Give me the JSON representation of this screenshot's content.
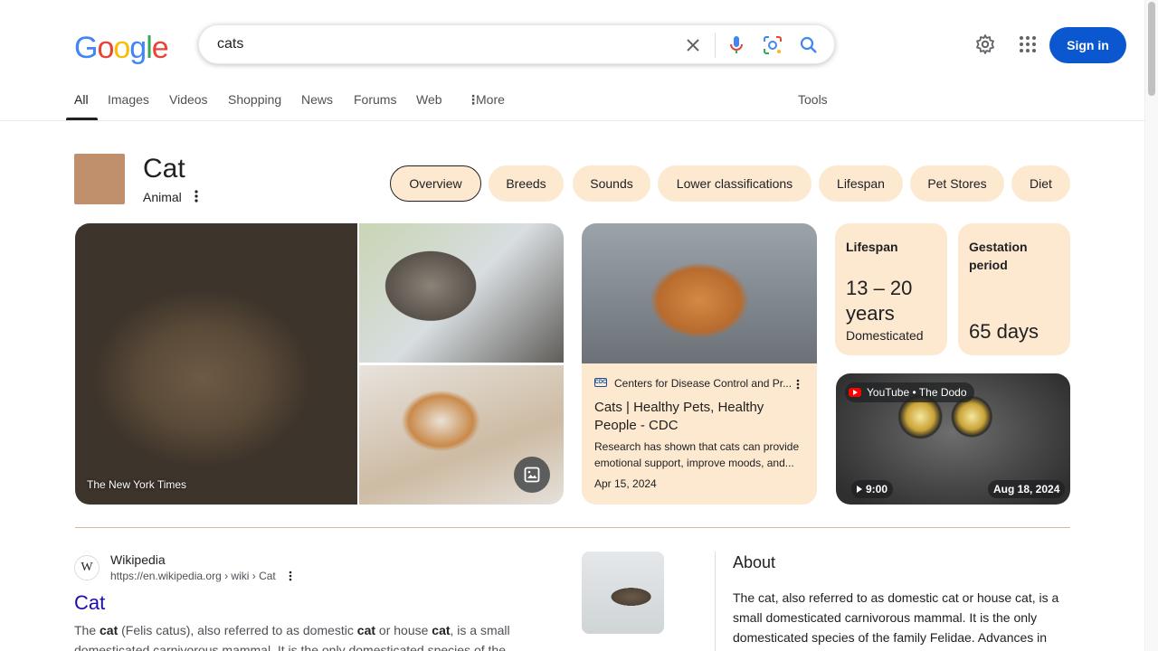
{
  "logo": {
    "letters": [
      "G",
      "o",
      "o",
      "g",
      "l",
      "e"
    ],
    "colors": [
      "#4285f4",
      "#ea4335",
      "#fbbc05",
      "#4285f4",
      "#34a853",
      "#ea4335"
    ]
  },
  "search": {
    "query": "cats"
  },
  "header": {
    "sign_in": "Sign in"
  },
  "tabs": [
    "All",
    "Images",
    "Videos",
    "Shopping",
    "News",
    "Forums",
    "Web",
    "More"
  ],
  "tools": "Tools",
  "entity": {
    "title": "Cat",
    "subtitle": "Animal"
  },
  "chips": [
    "Overview",
    "Breeds",
    "Sounds",
    "Lower classifications",
    "Lifespan",
    "Pet Stores",
    "Diet"
  ],
  "images": {
    "credit": "The New York Times"
  },
  "cdc_card": {
    "source": "Centers for Disease Control and Pr...",
    "source_badge": "CDC",
    "title": "Cats | Healthy Pets, Healthy People - CDC",
    "snippet": "Research has shown that cats can provide emotional support, improve moods, and...",
    "date": "Apr 15, 2024"
  },
  "facts": {
    "lifespan": {
      "label": "Lifespan",
      "value": "13 – 20 years",
      "note": "Domesticated"
    },
    "gestation": {
      "label": "Gestation period",
      "value": "65 days"
    }
  },
  "video": {
    "source": "YouTube • The Dodo",
    "duration": "9:00",
    "date": "Aug 18, 2024"
  },
  "wiki": {
    "site": "Wikipedia",
    "url": "https://en.wikipedia.org › wiki › Cat",
    "title": "Cat",
    "snippet_html_parts": [
      "The ",
      "cat",
      " (Felis catus), also referred to as domestic ",
      "cat",
      " or house ",
      "cat",
      ", is a small domesticated carnivorous mammal. It is the only domesticated species of the"
    ]
  },
  "about": {
    "title": "About",
    "text": "The cat, also referred to as domestic cat or house cat, is a small domesticated carnivorous mammal. It is the only domesticated species of the family Felidae. Advances in"
  },
  "colors": {
    "accent": "#0b57d0",
    "chip_bg": "#fde8d0",
    "link": "#1a0dab"
  }
}
